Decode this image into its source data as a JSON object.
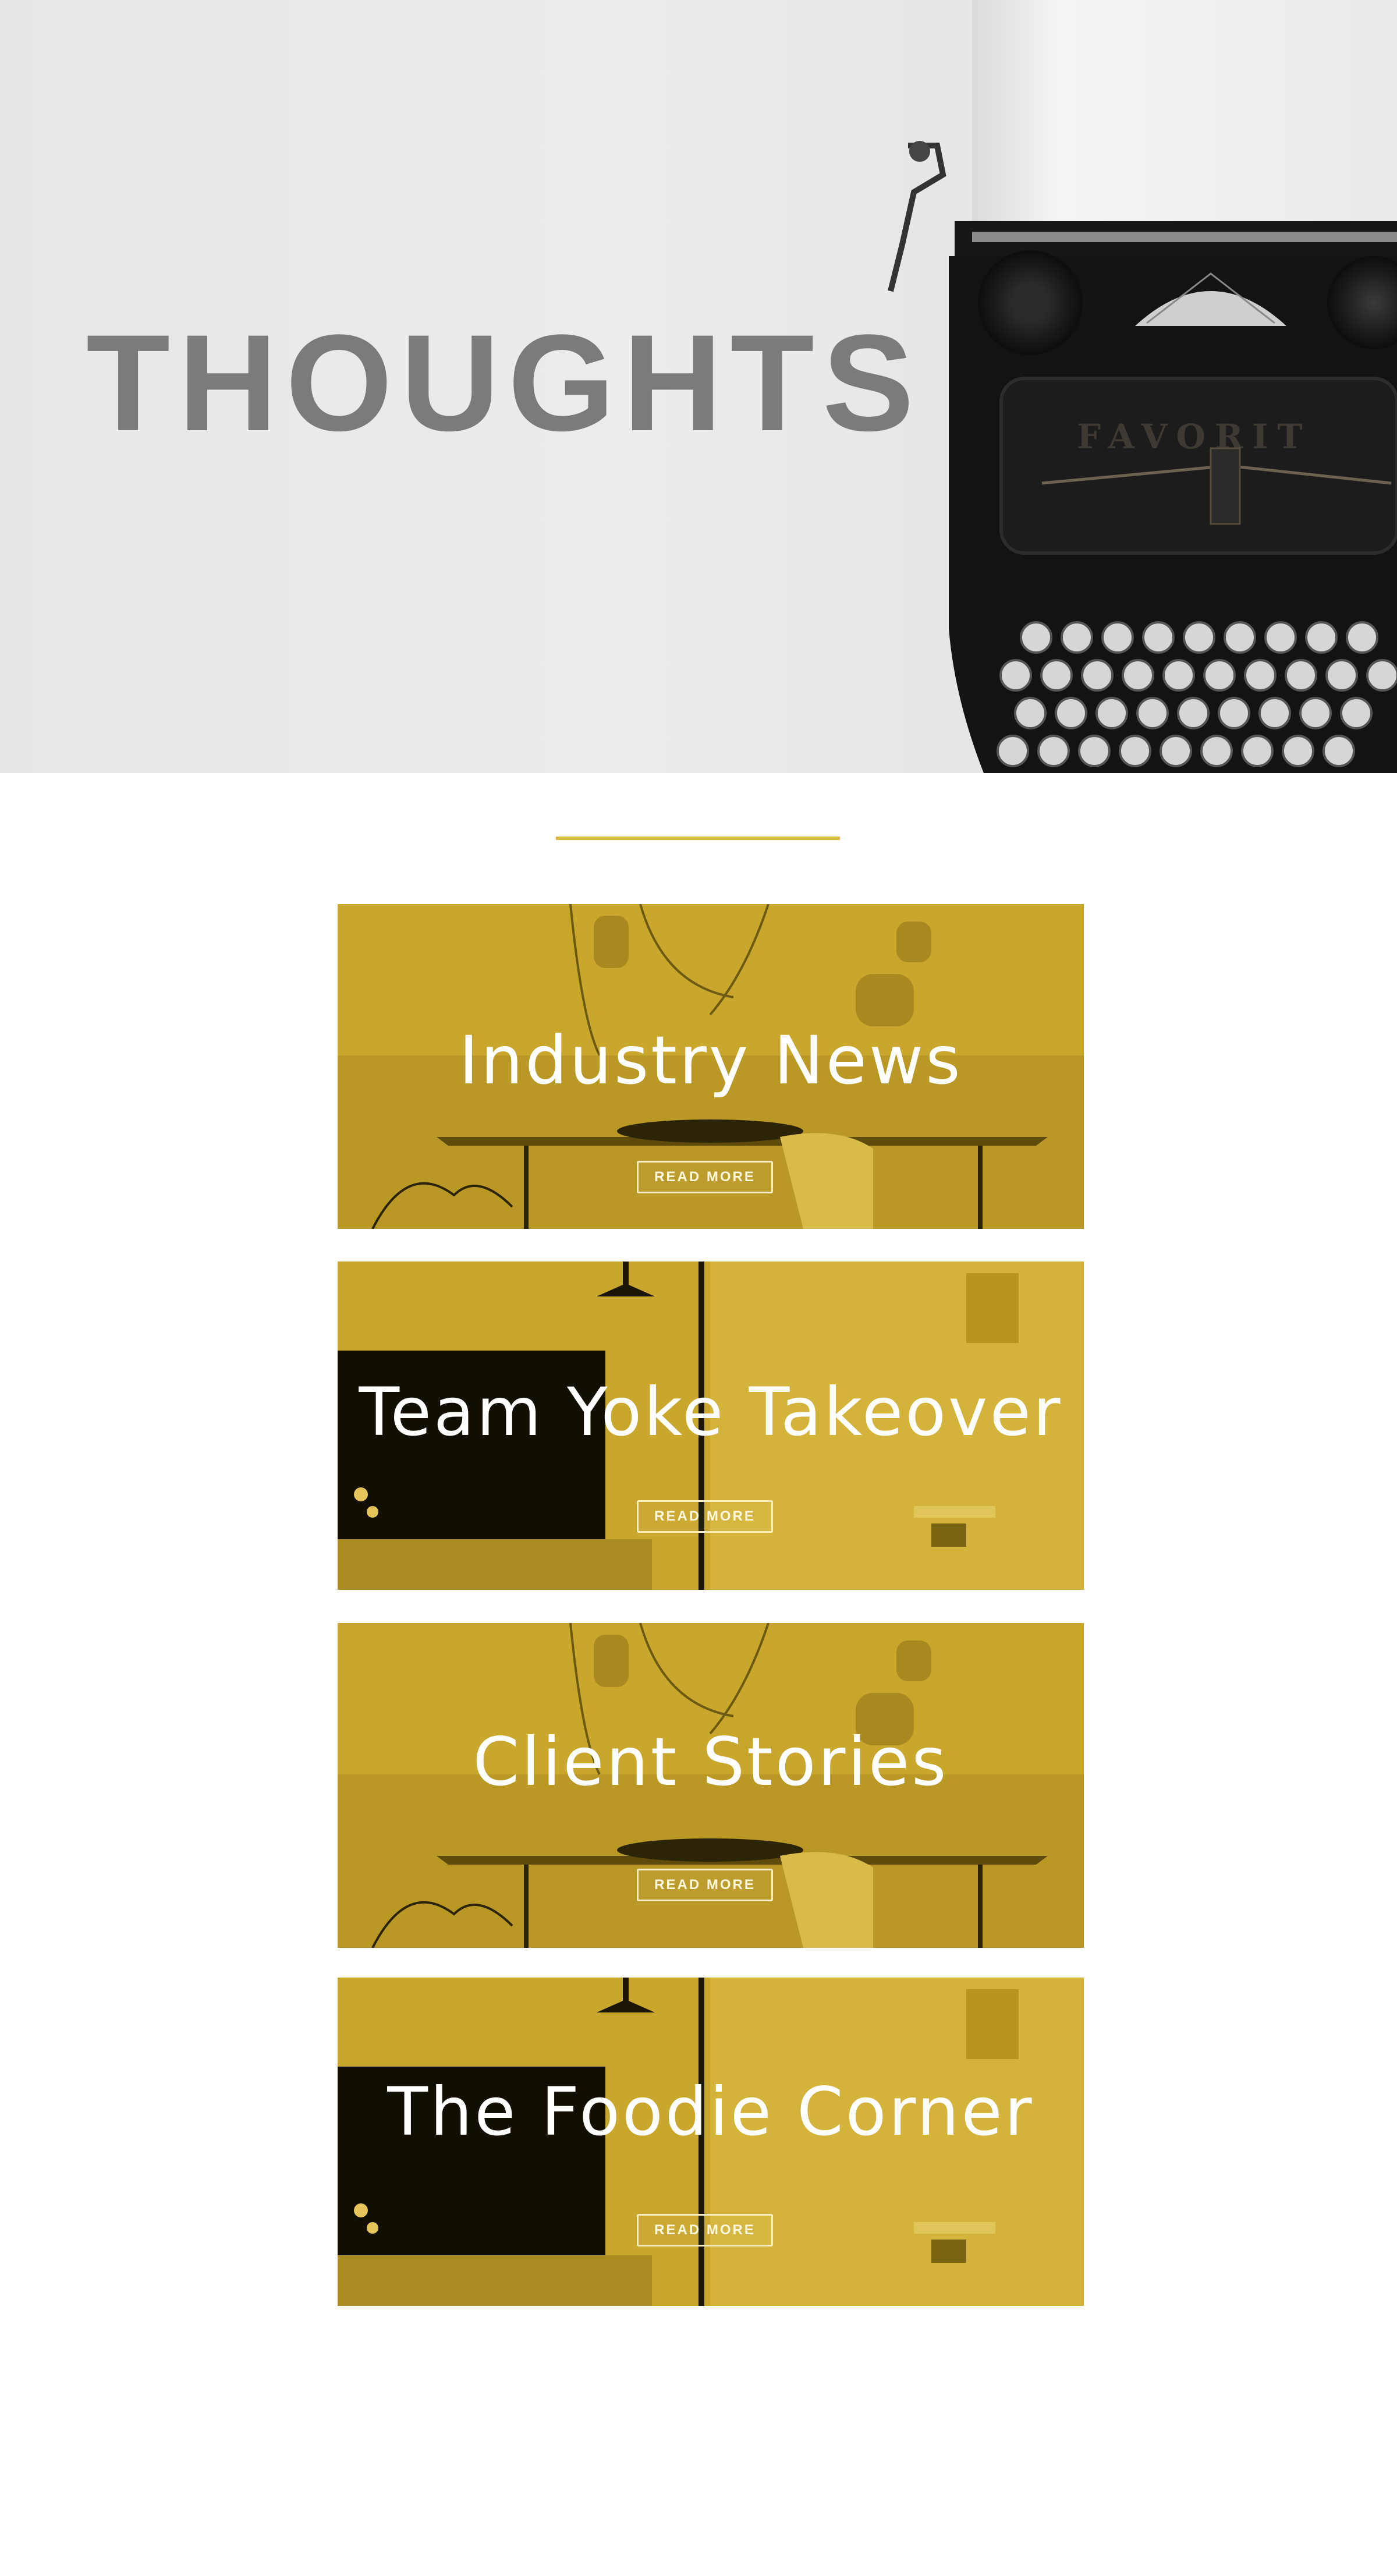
{
  "hero": {
    "title": "THOUGHTS"
  },
  "colors": {
    "accent": "#d9bb3f",
    "overlay": "#c9a52b",
    "title_gray": "#7b7b7b"
  },
  "posts": [
    {
      "title": "Industry News",
      "button": "READ MORE",
      "scene": "dining-table-lamps"
    },
    {
      "title": "Team Yoke Takeover",
      "button": "READ MORE",
      "scene": "room-wall-lamp"
    },
    {
      "title": "Client Stories",
      "button": "READ MORE",
      "scene": "dining-table-lamps"
    },
    {
      "title": "The Foodie Corner",
      "button": "READ MORE",
      "scene": "room-wall-lamp"
    }
  ]
}
